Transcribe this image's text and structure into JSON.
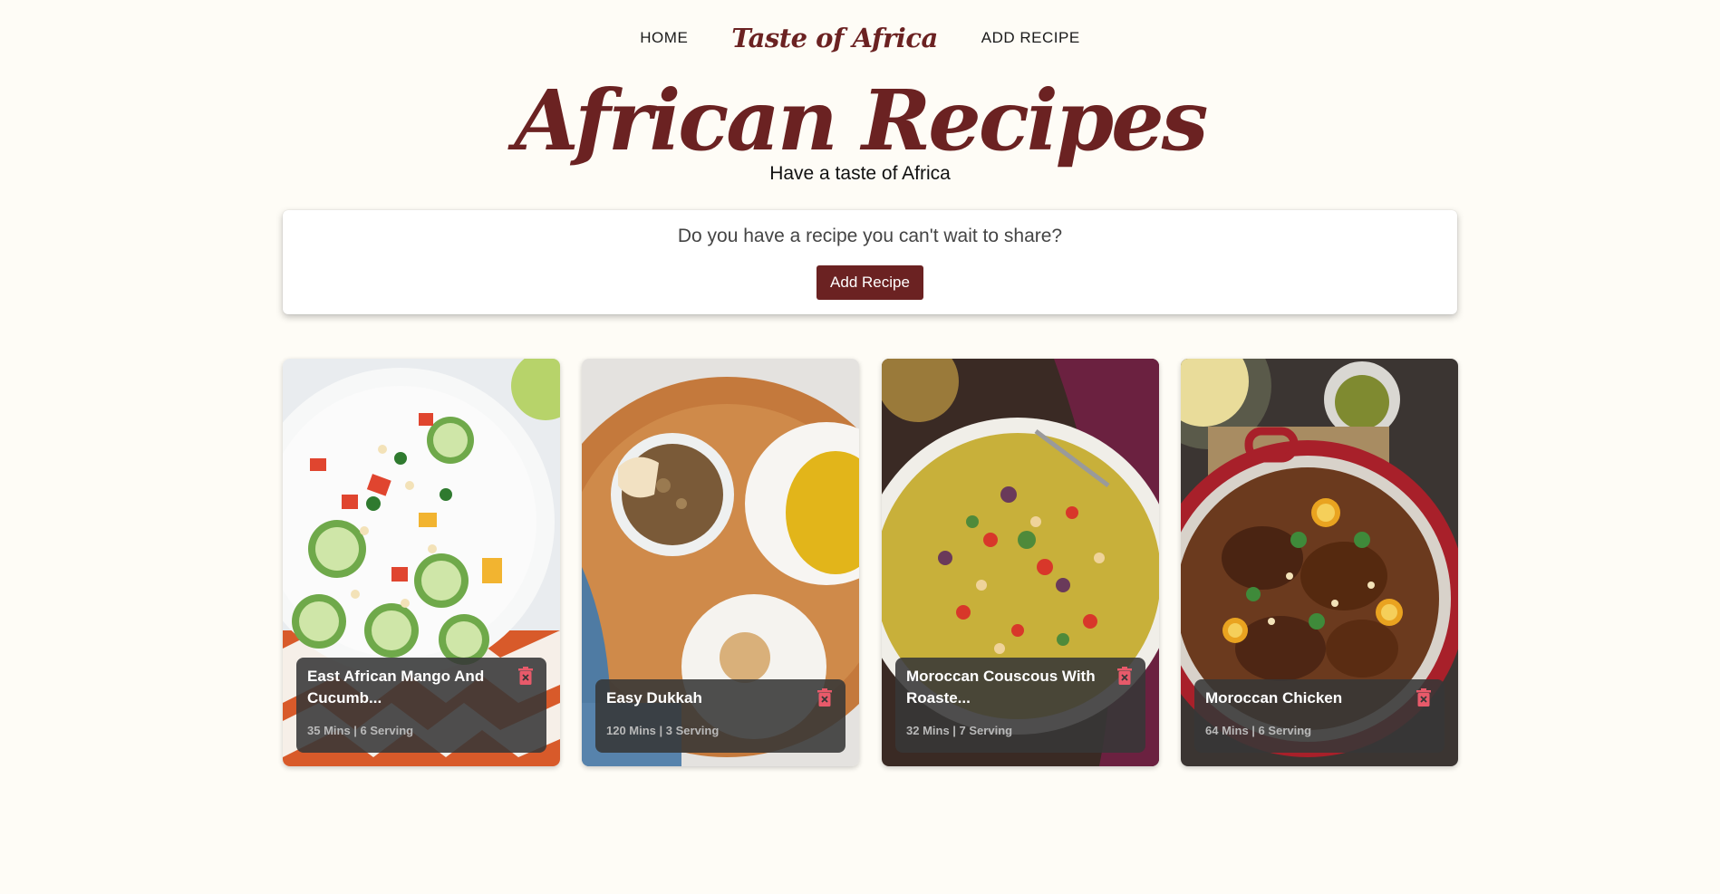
{
  "nav": {
    "home": "HOME",
    "logo": "Taste of Africa",
    "add_recipe": "ADD RECIPE"
  },
  "hero": {
    "title": "African Recipes",
    "subtitle": "Have a taste of Africa"
  },
  "share": {
    "question": "Do you have a recipe you can't wait to share?",
    "button_label": "Add Recipe"
  },
  "colors": {
    "brand": "#6b2222",
    "background": "#fefcf6",
    "delete_icon": "#e85a6a"
  },
  "recipes": [
    {
      "title": "East African Mango And Cucumb...",
      "meta": "35 Mins | 6 Serving",
      "image": "mango-cucumber-salad"
    },
    {
      "title": "Easy Dukkah",
      "meta": "120 Mins | 3 Serving",
      "image": "dukkah-bowl"
    },
    {
      "title": "Moroccan Couscous With Roaste...",
      "meta": "32 Mins | 7 Serving",
      "image": "couscous-platter"
    },
    {
      "title": "Moroccan Chicken",
      "meta": "64 Mins | 6 Serving",
      "image": "chicken-pot"
    }
  ],
  "icons": {
    "delete": "trash-icon"
  }
}
